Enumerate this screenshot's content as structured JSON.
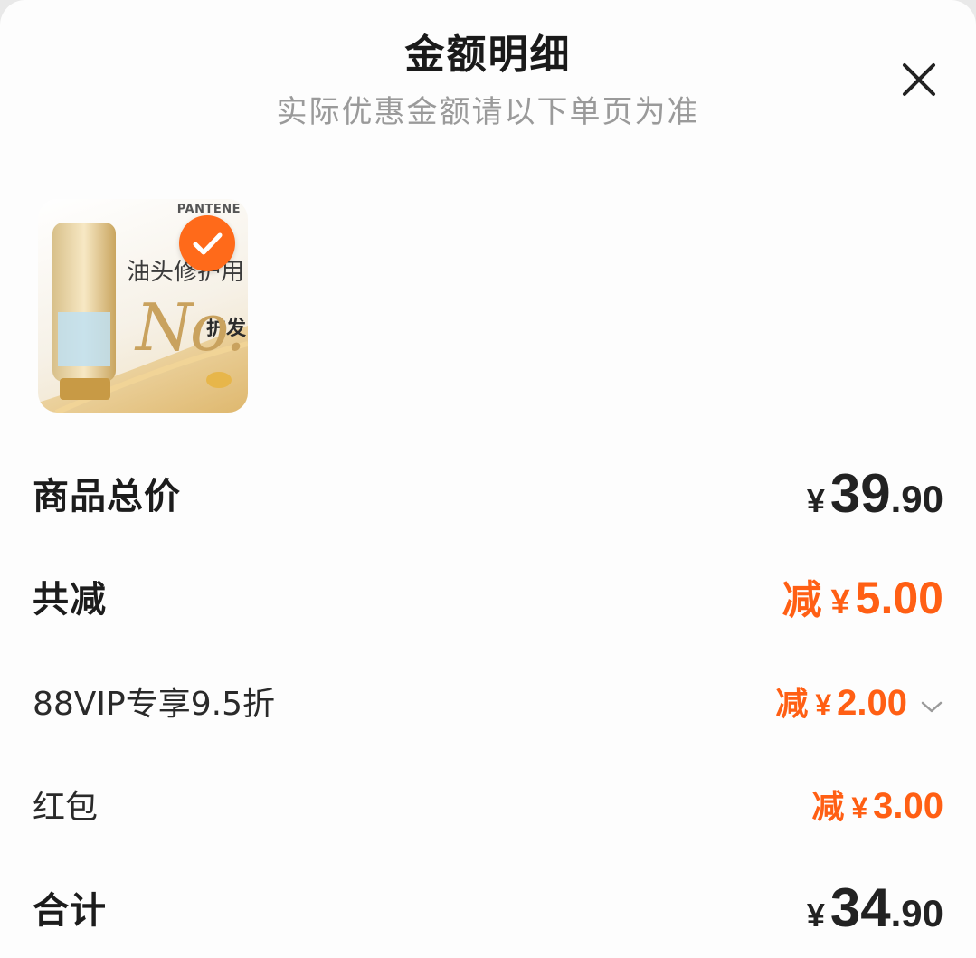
{
  "header": {
    "title": "金额明细",
    "subtitle": "实际优惠金额请以下单页为准"
  },
  "product": {
    "thumb_text": "油头修护用",
    "thumb_badge": "护发",
    "thumb_no1": "No.1",
    "brand": "PANTENE",
    "selected": true
  },
  "summary": {
    "total_label": "商品总价",
    "total_yen": "¥",
    "total_int": "39",
    "total_dec": ".90",
    "discount_label": "共减",
    "discount_prefix": "减",
    "discount_yen": "¥",
    "discount_value": "5.00",
    "items": [
      {
        "label": "88VIP专享9.5折",
        "prefix": "减",
        "yen": "¥",
        "value": "2.00",
        "expandable": true
      },
      {
        "label": "红包",
        "prefix": "减",
        "yen": "¥",
        "value": "3.00",
        "expandable": false
      }
    ],
    "final_label": "合计",
    "final_yen": "¥",
    "final_int": "34",
    "final_dec": ".90"
  },
  "colors": {
    "accent": "#ff5f14",
    "check": "#ff6a1a"
  },
  "icons": {
    "close": "close-icon",
    "check": "check-icon",
    "expand": "chevron-down-icon"
  }
}
